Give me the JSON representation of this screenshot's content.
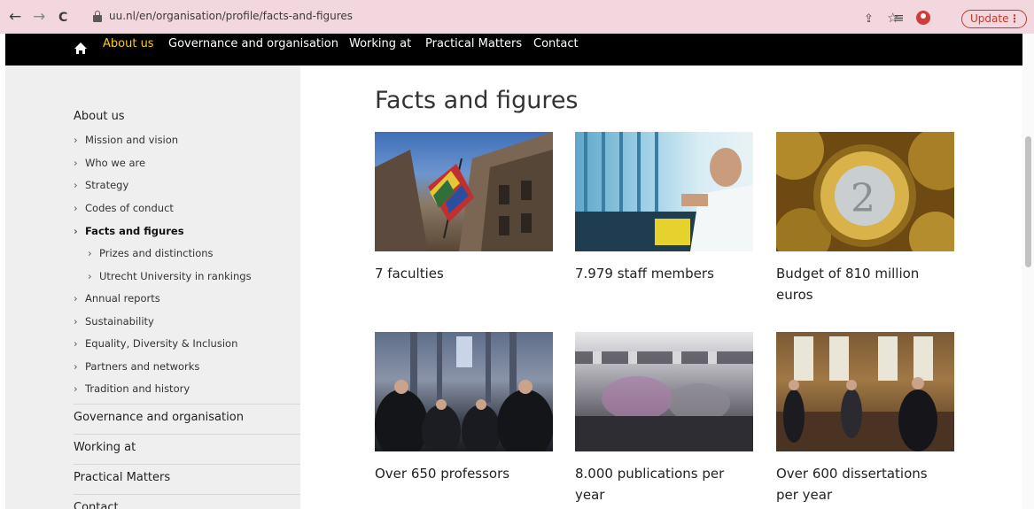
{
  "browser": {
    "back_icon": "←",
    "forward_icon": "→",
    "reload_icon": "C",
    "url": "uu.nl/en/organisation/profile/facts-and-figures",
    "share_icon": "⇪",
    "star_icon": "☆",
    "reading_list_icon": "≡",
    "update_label": "Update",
    "menu_icon": "⋮"
  },
  "topnav": {
    "items": [
      "About us",
      "Governance and organisation",
      "Working at",
      "Practical Matters",
      "Contact"
    ],
    "active_color": "#ffcd00"
  },
  "sidebar": {
    "heading": "About us",
    "chevron": "›",
    "items": [
      "Mission and vision",
      "Who we are",
      "Strategy",
      "Codes of conduct",
      "Facts and figures",
      "Prizes and distinctions",
      "Utrecht University in rankings",
      "Annual reports",
      "Sustainability",
      "Equality, Diversity & Inclusion",
      "Partners and networks",
      "Tradition and history"
    ],
    "sections": [
      "Governance and organisation",
      "Working at",
      "Practical Matters",
      "Contact"
    ]
  },
  "main": {
    "title": "Facts and figures",
    "cards": [
      {
        "label": "7 faculties"
      },
      {
        "label": "7.979 staff members"
      },
      {
        "label": "Budget of 810 million euros"
      },
      {
        "label": "Over 650 professors"
      },
      {
        "label": "8.000 publications per year"
      },
      {
        "label": "Over 600 dissertations per year"
      }
    ]
  }
}
